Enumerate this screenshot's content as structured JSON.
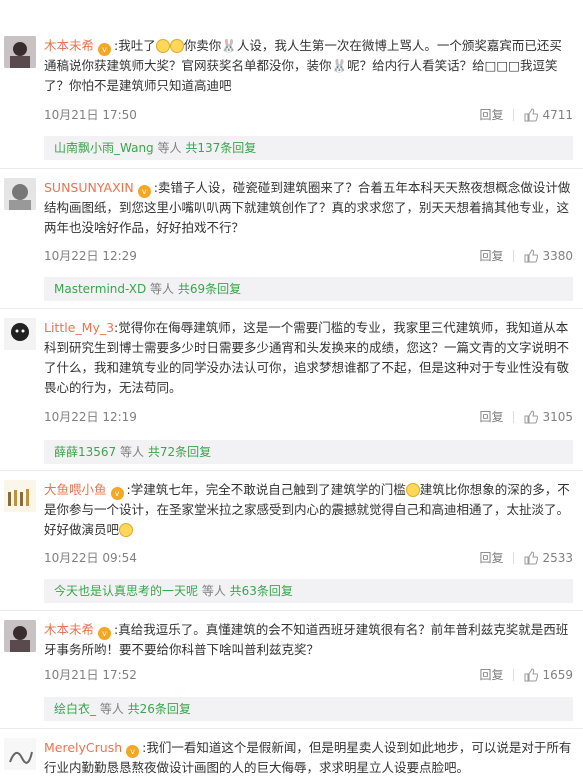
{
  "comments": [
    {
      "username": "木本未希",
      "text_a": "我吐了",
      "text_b": "你卖你",
      "text_c": "人设，我人生第一次在微博上骂人。一个颁奖嘉宾而已还买通稿说你获建筑师大奖？官网获奖名单都没你，装你",
      "text_d": "呢？给内行人看笑话？给□□□我逗笑了？你怕不是建筑师只知道高迪吧",
      "date": "10月21日 17:50",
      "reply_label": "回复",
      "likes": "4711",
      "reply_user": "山南飘小雨_Wang",
      "reply_mid": " 等人 ",
      "reply_total": "共137条回复"
    },
    {
      "username": "SUNSUNYAXIN",
      "text": "卖错子人设，碰瓷碰到建筑圈来了？合着五年本科天天熬夜想概念做设计做结构画图纸，到您这里小嘴叭叭两下就建筑创作了？真的求求您了，别天天想着搞其他专业，这两年也没啥好作品，好好拍戏不行？",
      "date": "10月22日 12:29",
      "reply_label": "回复",
      "likes": "3380",
      "reply_user": "Mastermind-XD",
      "reply_mid": " 等人 ",
      "reply_total": "共69条回复"
    },
    {
      "username": "Little_My_3",
      "text": "觉得你在侮辱建筑师，这是一个需要门槛的专业，我家里三代建筑师，我知道从本科到研究生到博士需要多少时日需要多少通宵和头发换来的成绩，您这？一篇文青的文字说明不了什么，我和建筑专业的同学没办法认可你，追求梦想谁都了不起，但是这种对于专业性没有敬畏心的行为，无法苟同。",
      "date": "10月22日 12:19",
      "reply_label": "回复",
      "likes": "3105",
      "reply_user": "薛薛13567",
      "reply_mid": " 等人 ",
      "reply_total": "共72条回复"
    },
    {
      "username": "大鱼喂小鱼",
      "text_a": "学建筑七年，完全不敢说自己触到了建筑学的门槛",
      "text_b": "建筑比你想象的深的多，不是你参与一个设计，在圣家堂米拉之家感受到内心的震撼就觉得自己和高迪相通了，太扯淡了。好好做演员吧",
      "date": "10月22日 09:54",
      "reply_label": "回复",
      "likes": "2533",
      "reply_user": "今天也是认真思考的一天呢",
      "reply_mid": " 等人 ",
      "reply_total": "共63条回复"
    },
    {
      "username": "木本未希",
      "text": "真给我逗乐了。真懂建筑的会不知道西班牙建筑很有名？前年普利兹克奖就是西班牙事务所哟！要不要给你科普下啥叫普利兹克奖？",
      "date": "10月21日 17:52",
      "reply_label": "回复",
      "likes": "1659",
      "reply_user": "绘白衣_",
      "reply_mid": " 等人 ",
      "reply_total": "共26条回复"
    },
    {
      "username": "MerelyCrush",
      "text": "我们一看知道这个是假新闻，但是明星卖人设到如此地步，可以说是对于所有行业内勤勤恳恳熬夜做设计画图的人的巨大侮辱，求求明星立人设要点脸吧。"
    }
  ],
  "colors": {
    "username": "#eb7350",
    "reply_user": "#3aa54b",
    "meta": "#808080"
  }
}
